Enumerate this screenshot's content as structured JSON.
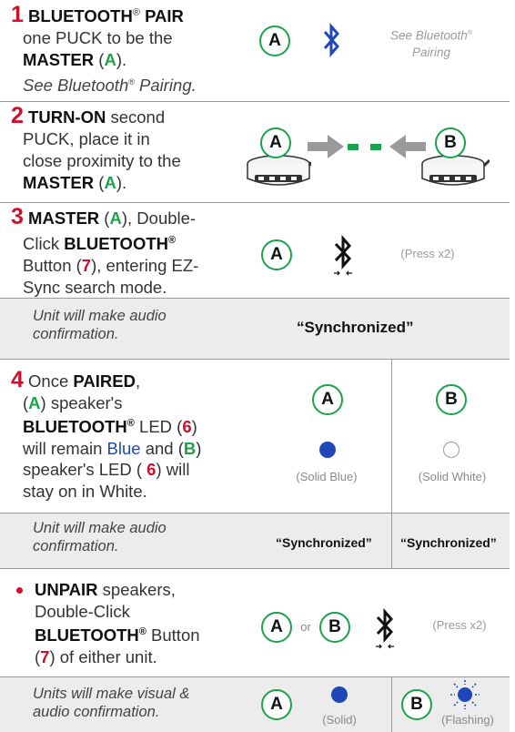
{
  "step1": {
    "number": "1",
    "line1": "BLUETOOTH",
    "line1_reg": "®",
    "line1_b": " PAIR",
    "line2": "one PUCK to be the",
    "master": "MASTER",
    "open_paren": " (",
    "a": "A",
    "close": ").",
    "see": "See Bluetooth",
    "see_reg": "®",
    "see_tail": " Pairing.",
    "circle_a": "A",
    "hint_line1": "See Bluetooth",
    "hint_reg": "®",
    "hint_line2": "Pairing"
  },
  "step2": {
    "number": "2",
    "turn_on": "TURN-ON",
    "line1_tail": " second",
    "line2": "PUCK, place it in",
    "line3": "close proximity to the",
    "master": "MASTER",
    "open_paren": " (",
    "a": "A",
    "close": ").",
    "circle_a": "A",
    "circle_b": "B"
  },
  "step3": {
    "number": "3",
    "master": "MASTER",
    "open_paren": " (",
    "a": "A",
    "close_comma": "), Double-",
    "click": "Click ",
    "bt": "BLUETOOTH",
    "reg": "®",
    "button": "Button (",
    "seven": "7",
    "entering": "), entering EZ-",
    "line4": "Sync search mode.",
    "circle_a": "A",
    "press": "(Press x2)"
  },
  "conf1": {
    "text1": "Unit will make audio",
    "text2": "confirmation.",
    "label": "“Synchronized”"
  },
  "step4": {
    "number": "4",
    "once": "Once ",
    "paired": "PAIRED",
    "comma": ",",
    "a_open": "(",
    "a": "A",
    "a_close": ") speaker's",
    "bt": "BLUETOOTH",
    "reg": "®",
    "led": " LED (",
    "six": "6",
    "led_close": ")",
    "remain": "will remain ",
    "blue": "Blue",
    "and": " and (",
    "b": "B",
    "and_close": ")",
    "speaker_led": "speaker's LED ( ",
    "six2": "6",
    "will": ") will",
    "stay": "stay on in White.",
    "circle_a": "A",
    "circle_b": "B",
    "solid_blue": "(Solid Blue)",
    "solid_white": "(Solid White)"
  },
  "conf2": {
    "text1": "Unit will make audio",
    "text2": "confirmation.",
    "label_a": "“Synchronized”",
    "label_b": "“Synchronized”"
  },
  "unpair": {
    "unpair": "UNPAIR",
    "speakers": " speakers,",
    "line2": "Double-Click",
    "bt": "BLUETOOTH",
    "reg": "®",
    "button": " Button",
    "open": "(",
    "seven": "7",
    "tail": ") of either unit.",
    "circle_a": "A",
    "or": "or",
    "circle_b": "B",
    "press": "(Press x2)"
  },
  "conf3": {
    "text1": "Units will make visual &",
    "text2": "audio confirmation.",
    "circle_a": "A",
    "solid": "(Solid)",
    "circle_b": "B",
    "flashing": "(Flashing)"
  },
  "colors": {
    "red": "#d0102a",
    "green": "#1aa34a",
    "blue": "#1f47b8",
    "gray_band": "#ececec"
  },
  "icons": [
    "bluetooth-icon",
    "arrow-right-icon",
    "arrow-left-icon",
    "speaker-puck-icon",
    "led-dot-icon",
    "flashing-led-icon"
  ]
}
